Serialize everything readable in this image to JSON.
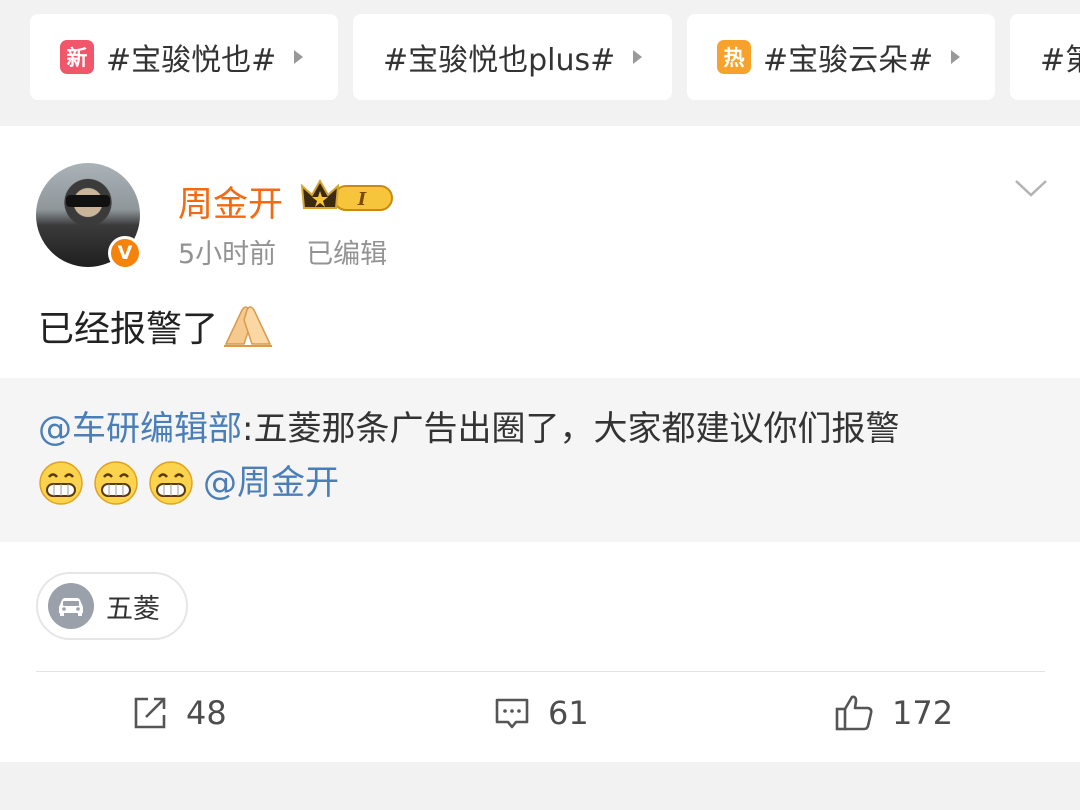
{
  "topics": [
    {
      "badge": "新",
      "badge_color": "#f2566b",
      "label": "#宝骏悦也#"
    },
    {
      "badge": "",
      "badge_color": "",
      "label": "#宝骏悦也plus#"
    },
    {
      "badge": "热",
      "badge_color": "#f7a32b",
      "label": "#宝骏云朵#"
    },
    {
      "badge": "",
      "badge_color": "",
      "label": "#第"
    }
  ],
  "post": {
    "username": "周金开",
    "member_level": "I",
    "verified_mark": "V",
    "time": "5小时前",
    "edited": "已编辑",
    "text": "已经报警了",
    "text_emoji": "hands-pressed-icon"
  },
  "repost": {
    "author": "@车研编辑部",
    "text": ":五菱那条广告出圈了，大家都建议你们报警",
    "emoji": "grinning-face-icon",
    "mention": "@周金开"
  },
  "tag": {
    "label": "五菱",
    "icon": "car-icon"
  },
  "actions": {
    "repost_count": "48",
    "comment_count": "61",
    "like_count": "172"
  },
  "colors": {
    "username": "#f36a12",
    "link": "#4a7eb8",
    "verified": "#f5820a"
  }
}
